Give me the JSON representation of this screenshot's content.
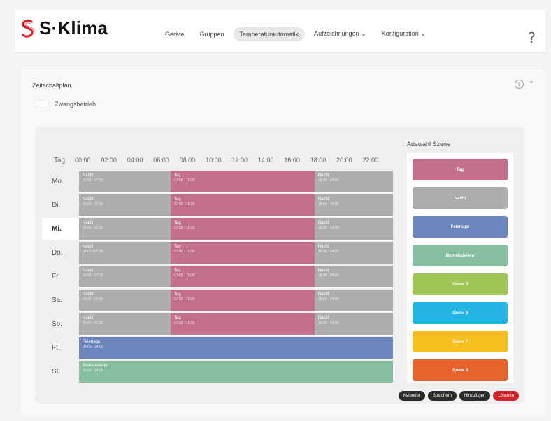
{
  "brand": {
    "name": "S·Klima",
    "logo_color": "#d3212a"
  },
  "nav": {
    "items": [
      {
        "label": "Geräte"
      },
      {
        "label": "Gruppen"
      },
      {
        "label": "Temperaturautomatik",
        "active": true
      },
      {
        "label": "Aufzeichnungen ⌄"
      },
      {
        "label": "Konfiguration ⌄"
      }
    ],
    "help": "?"
  },
  "card": {
    "title": "Zeitschaltplan",
    "collapse_icon": "chevron-up-icon",
    "info": "i",
    "chevron": "⌃",
    "toggle_label": "Zwangsbetrieb"
  },
  "schedule": {
    "day_header": "Tag",
    "times": [
      "00:00",
      "02:00",
      "04:00",
      "06:00",
      "08:00",
      "10:00",
      "12:00",
      "14:00",
      "16:00",
      "18:00",
      "20:00",
      "22:00"
    ],
    "days": [
      {
        "label": "Mo.",
        "segments": [
          {
            "name": "Nacht",
            "time": "00:00 - 07:00",
            "type": "night",
            "start": 0,
            "end": 7
          },
          {
            "name": "Tag",
            "time": "07:00 - 18:00",
            "type": "day",
            "start": 7,
            "end": 18
          },
          {
            "name": "Nacht",
            "time": "18:00 - 24:00",
            "type": "night",
            "start": 18,
            "end": 24
          }
        ]
      },
      {
        "label": "Di.",
        "segments": [
          {
            "name": "Nacht",
            "time": "00:00 - 07:00",
            "type": "night",
            "start": 0,
            "end": 7
          },
          {
            "name": "Tag",
            "time": "07:00 - 18:00",
            "type": "day",
            "start": 7,
            "end": 18
          },
          {
            "name": "Nacht",
            "time": "18:00 - 24:00",
            "type": "night",
            "start": 18,
            "end": 24
          }
        ]
      },
      {
        "label": "Mi.",
        "selected": true,
        "segments": [
          {
            "name": "Nacht",
            "time": "00:00 - 07:00",
            "type": "night",
            "start": 0,
            "end": 7
          },
          {
            "name": "Tag",
            "time": "07:00 - 18:00",
            "type": "day",
            "start": 7,
            "end": 18
          },
          {
            "name": "Nacht",
            "time": "18:00 - 24:00",
            "type": "night",
            "start": 18,
            "end": 24
          }
        ]
      },
      {
        "label": "Do.",
        "segments": [
          {
            "name": "Nacht",
            "time": "00:00 - 07:00",
            "type": "night",
            "start": 0,
            "end": 7
          },
          {
            "name": "Tag",
            "time": "07:00 - 18:00",
            "type": "day",
            "start": 7,
            "end": 18
          },
          {
            "name": "Nacht",
            "time": "18:00 - 24:00",
            "type": "night",
            "start": 18,
            "end": 24
          }
        ]
      },
      {
        "label": "Fr.",
        "segments": [
          {
            "name": "Nacht",
            "time": "00:00 - 07:00",
            "type": "night",
            "start": 0,
            "end": 7
          },
          {
            "name": "Tag",
            "time": "07:00 - 18:00",
            "type": "day",
            "start": 7,
            "end": 18
          },
          {
            "name": "Nacht",
            "time": "18:00 - 24:00",
            "type": "night",
            "start": 18,
            "end": 24
          }
        ]
      },
      {
        "label": "Sa.",
        "segments": [
          {
            "name": "Nacht",
            "time": "00:00 - 07:00",
            "type": "night",
            "start": 0,
            "end": 7
          },
          {
            "name": "Tag",
            "time": "07:00 - 18:00",
            "type": "day",
            "start": 7,
            "end": 18
          },
          {
            "name": "Nacht",
            "time": "18:00 - 24:00",
            "type": "night",
            "start": 18,
            "end": 24
          }
        ]
      },
      {
        "label": "So.",
        "segments": [
          {
            "name": "Nacht",
            "time": "00:00 - 07:00",
            "type": "night",
            "start": 0,
            "end": 7
          },
          {
            "name": "Tag",
            "time": "07:00 - 18:00",
            "type": "day",
            "start": 7,
            "end": 18
          },
          {
            "name": "Nacht",
            "time": "18:00 - 24:00",
            "type": "night",
            "start": 18,
            "end": 24
          }
        ]
      },
      {
        "label": "Ft.",
        "segments": [
          {
            "name": "Feiertage",
            "time": "00:00 - 24:00",
            "type": "holiday",
            "start": 0,
            "end": 24
          }
        ]
      },
      {
        "label": "St.",
        "segments": [
          {
            "name": "Betriebsferien",
            "time": "00:00 - 24:00",
            "type": "rest",
            "start": 0,
            "end": 24
          }
        ]
      }
    ]
  },
  "scenes": {
    "title": "Auswahl Szene",
    "items": [
      {
        "label": "Tag",
        "color": "#c2708a"
      },
      {
        "label": "Nacht",
        "color": "#adadad"
      },
      {
        "label": "Feiertage",
        "color": "#6c86bd"
      },
      {
        "label": "Betriebsferien",
        "color": "#86bfa0"
      },
      {
        "label": "Szene 5",
        "color": "#9fc657"
      },
      {
        "label": "Szene 6",
        "color": "#26b4e4"
      },
      {
        "label": "Szene 7",
        "color": "#f4c01f"
      },
      {
        "label": "Szene 8",
        "color": "#e8632a"
      }
    ]
  },
  "actions": [
    {
      "label": "Kalender"
    },
    {
      "label": "Speichern"
    },
    {
      "label": "Hinzufügen"
    },
    {
      "label": "Löschen",
      "danger": true
    }
  ]
}
